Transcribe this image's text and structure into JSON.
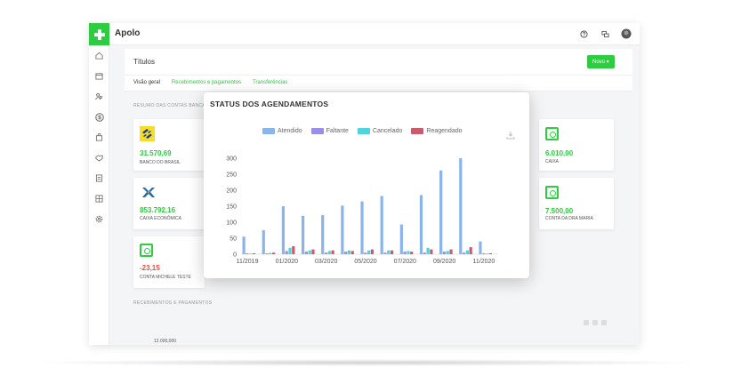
{
  "app": {
    "title": "Apolo"
  },
  "header": {
    "page_title": "Títulos",
    "new_button": "Novo ▾"
  },
  "tabs": [
    {
      "label": "Visão geral",
      "active": true
    },
    {
      "label": "Recebimentos e pagamentos",
      "active": false
    },
    {
      "label": "Transferências",
      "active": false
    }
  ],
  "sections": {
    "accounts_summary": "RESUMO DAS CONTAS BANCÁRIAS",
    "receipts_payments": "RECEBIMENTOS E PAGAMENTOS"
  },
  "accounts": [
    {
      "amount": "31.570,69",
      "name": "BANCO DO BRASIL",
      "icon": "banco-do-brasil-logo"
    },
    {
      "amount": "853.792,16",
      "name": "CAIXA ECONÔMICA",
      "icon": "caixa-logo"
    },
    {
      "amount": "-23,15",
      "name": "CONTA MICHELE TESTE",
      "icon": "safe-icon"
    },
    {
      "amount": "6.010,00",
      "name": "CAIXA",
      "icon": "safe-icon"
    },
    {
      "amount": "7.500,00",
      "name": "CONTA DA DRA MARIA",
      "icon": "safe-icon"
    }
  ],
  "bottom_chart": {
    "first_tick": "12.000,000"
  },
  "colors": {
    "brand_green": "#2ecc40",
    "atendido": "#8ab4ec",
    "faltante": "#9a8fe6",
    "cancelado": "#4dd4dc",
    "reagendado": "#c95b6e",
    "negative": "#e74c3c"
  },
  "chart_data": {
    "type": "bar",
    "title": "STATUS DOS AGENDAMENTOS",
    "categories": [
      "11/2019",
      "12/2019",
      "01/2020",
      "02/2020",
      "03/2020",
      "04/2020",
      "05/2020",
      "06/2020",
      "07/2020",
      "08/2020",
      "09/2020",
      "10/2020",
      "11/2020"
    ],
    "x_tick_labels": [
      "11/2019",
      "01/2020",
      "03/2020",
      "05/2020",
      "07/2020",
      "09/2020",
      "11/2020"
    ],
    "series": [
      {
        "name": "Atendido",
        "values": [
          55,
          75,
          150,
          120,
          122,
          152,
          165,
          182,
          93,
          185,
          262,
          300,
          40
        ]
      },
      {
        "name": "Faltante",
        "values": [
          3,
          3,
          10,
          8,
          5,
          8,
          5,
          5,
          8,
          5,
          8,
          5,
          3
        ]
      },
      {
        "name": "Cancelado",
        "values": [
          2,
          4,
          20,
          12,
          10,
          12,
          12,
          12,
          10,
          20,
          10,
          12,
          2
        ]
      },
      {
        "name": "Reagendado",
        "values": [
          3,
          5,
          25,
          15,
          12,
          10,
          15,
          12,
          8,
          15,
          15,
          22,
          3
        ]
      }
    ],
    "ylim": [
      0,
      300
    ],
    "yticks": [
      0,
      50,
      100,
      150,
      200,
      250,
      300
    ],
    "legend": "top",
    "grid": false
  }
}
